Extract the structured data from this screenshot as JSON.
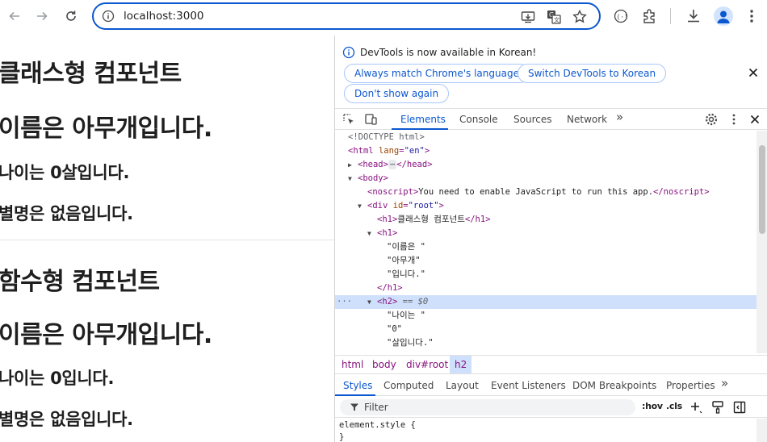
{
  "browser": {
    "url": "localhost:3000",
    "icons": [
      "back-arrow-icon",
      "forward-arrow-icon",
      "reload-icon",
      "site-info-icon",
      "install-app-icon",
      "translate-icon",
      "bookmark-star-icon",
      "extension-icon",
      "puzzle-icon",
      "download-icon",
      "profile-icon",
      "menu-icon"
    ]
  },
  "page": {
    "class_title": "클래스형 컴포넌트",
    "class_name": "이름은 아무개입니다.",
    "class_age": "나이는 0살입니다.",
    "class_nick": "별명은 없음입니다.",
    "func_title": "함수형 컴포넌트",
    "func_name": "이름은 아무개입니다.",
    "func_age": "나이는 0입니다.",
    "func_nick": "별명은 없음입니다."
  },
  "devtools": {
    "infobar": {
      "message": "DevTools is now available in Korean!",
      "btn_match": "Always match Chrome's language",
      "btn_switch": "Switch DevTools to Korean",
      "btn_dont": "Don't show again"
    },
    "tabs": [
      "Elements",
      "Console",
      "Sources",
      "Network",
      "»"
    ],
    "dom": {
      "doctype": "<!DOCTYPE html>",
      "html_open": "<html",
      "lang_attr": "lang",
      "lang_val": "\"en\"",
      "gt": ">",
      "head": "<head>",
      "head_close": "</head>",
      "ellipsis": "⋯",
      "body": "<body>",
      "noscript_open": "<noscript>",
      "noscript_text": "You need to enable JavaScript to run this app.",
      "noscript_close": "</noscript>",
      "div_open": "<div",
      "id_attr": "id",
      "id_val": "\"root\"",
      "h1_open": "<h1>",
      "h1_text": "클래스형 컴포넌트",
      "h1_close": "</h1>",
      "h1b_open": "<h1>",
      "t1": "\"이름은 \"",
      "t2": "\"아무개\"",
      "t3": "\"입니다.\"",
      "h1b_close": "</h1>",
      "dots": "···",
      "h2_open": "<h2>",
      "eq": "== $0",
      "t4": "\"나이는 \"",
      "t5": "\"0\"",
      "t6": "\"살입니다.\""
    },
    "breadcrumbs": [
      "html",
      "body",
      "div#root",
      "h2"
    ],
    "sub_tabs": [
      "Styles",
      "Computed",
      "Layout",
      "Event Listeners",
      "DOM Breakpoints",
      "Properties",
      "»"
    ],
    "filter_placeholder": "Filter",
    "hov": ":hov",
    "cls": ".cls",
    "style_rule": "element.style {",
    "style_close": "}"
  }
}
